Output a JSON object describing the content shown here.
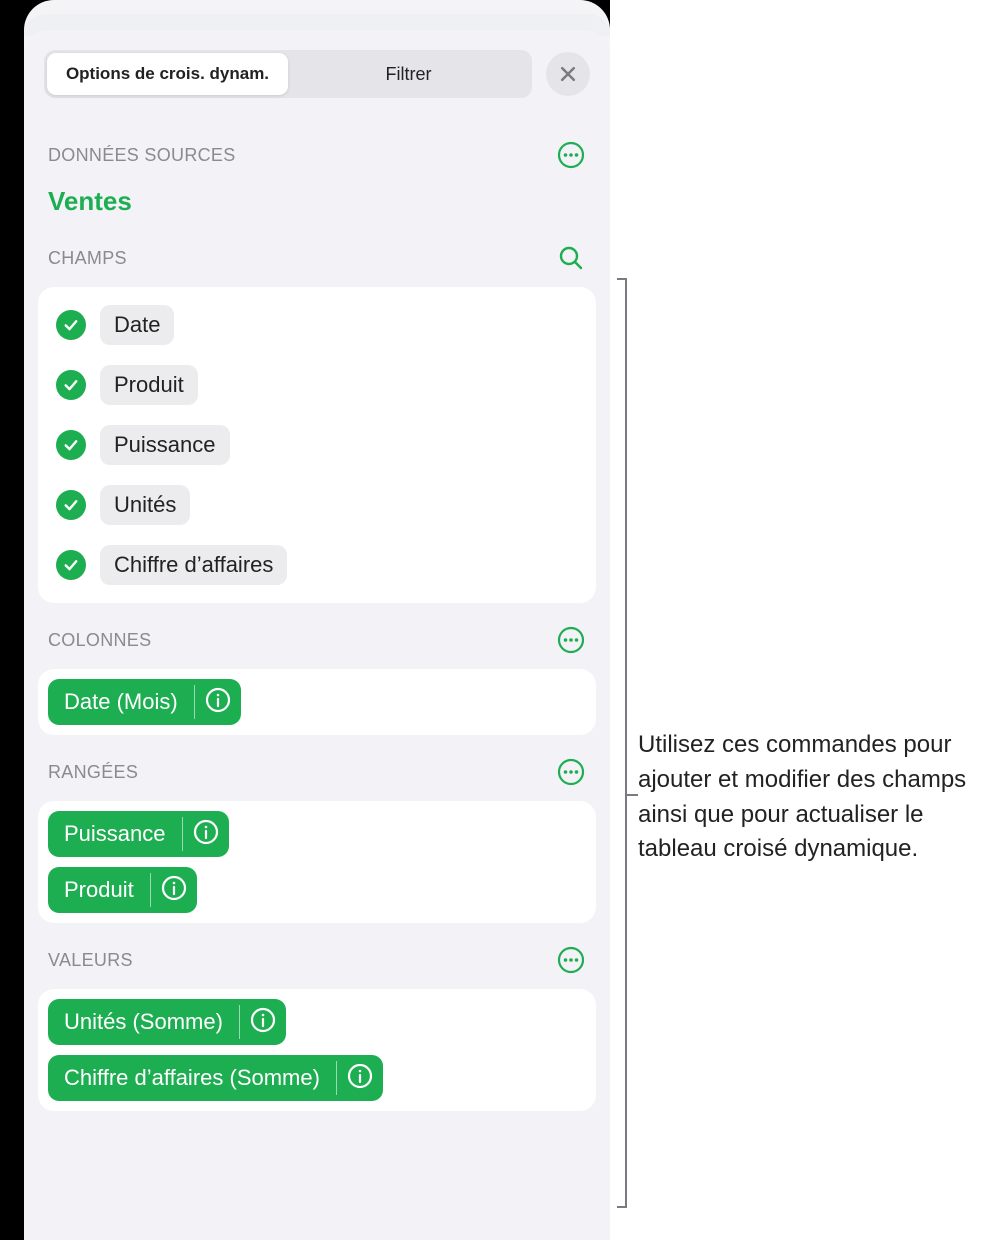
{
  "tabs": {
    "options": "Options de crois. dynam.",
    "filter": "Filtrer"
  },
  "sections": {
    "source_label": "DONNÉES SOURCES",
    "source_name": "Ventes",
    "fields_label": "CHAMPS",
    "columns_label": "COLONNES",
    "rows_label": "RANGÉES",
    "values_label": "VALEURS"
  },
  "fields": [
    {
      "name": "Date"
    },
    {
      "name": "Produit"
    },
    {
      "name": "Puissance"
    },
    {
      "name": "Unités"
    },
    {
      "name": "Chiffre d’affaires"
    }
  ],
  "columns": [
    {
      "label": "Date (Mois)"
    }
  ],
  "rows": [
    {
      "label": "Puissance"
    },
    {
      "label": "Produit"
    }
  ],
  "values": [
    {
      "label": "Unités (Somme)"
    },
    {
      "label": "Chiffre d’affaires (Somme)"
    }
  ],
  "callout": "Utilisez ces commandes pour ajouter et modifier des champs ainsi que pour actualiser le tableau croisé dynamique."
}
